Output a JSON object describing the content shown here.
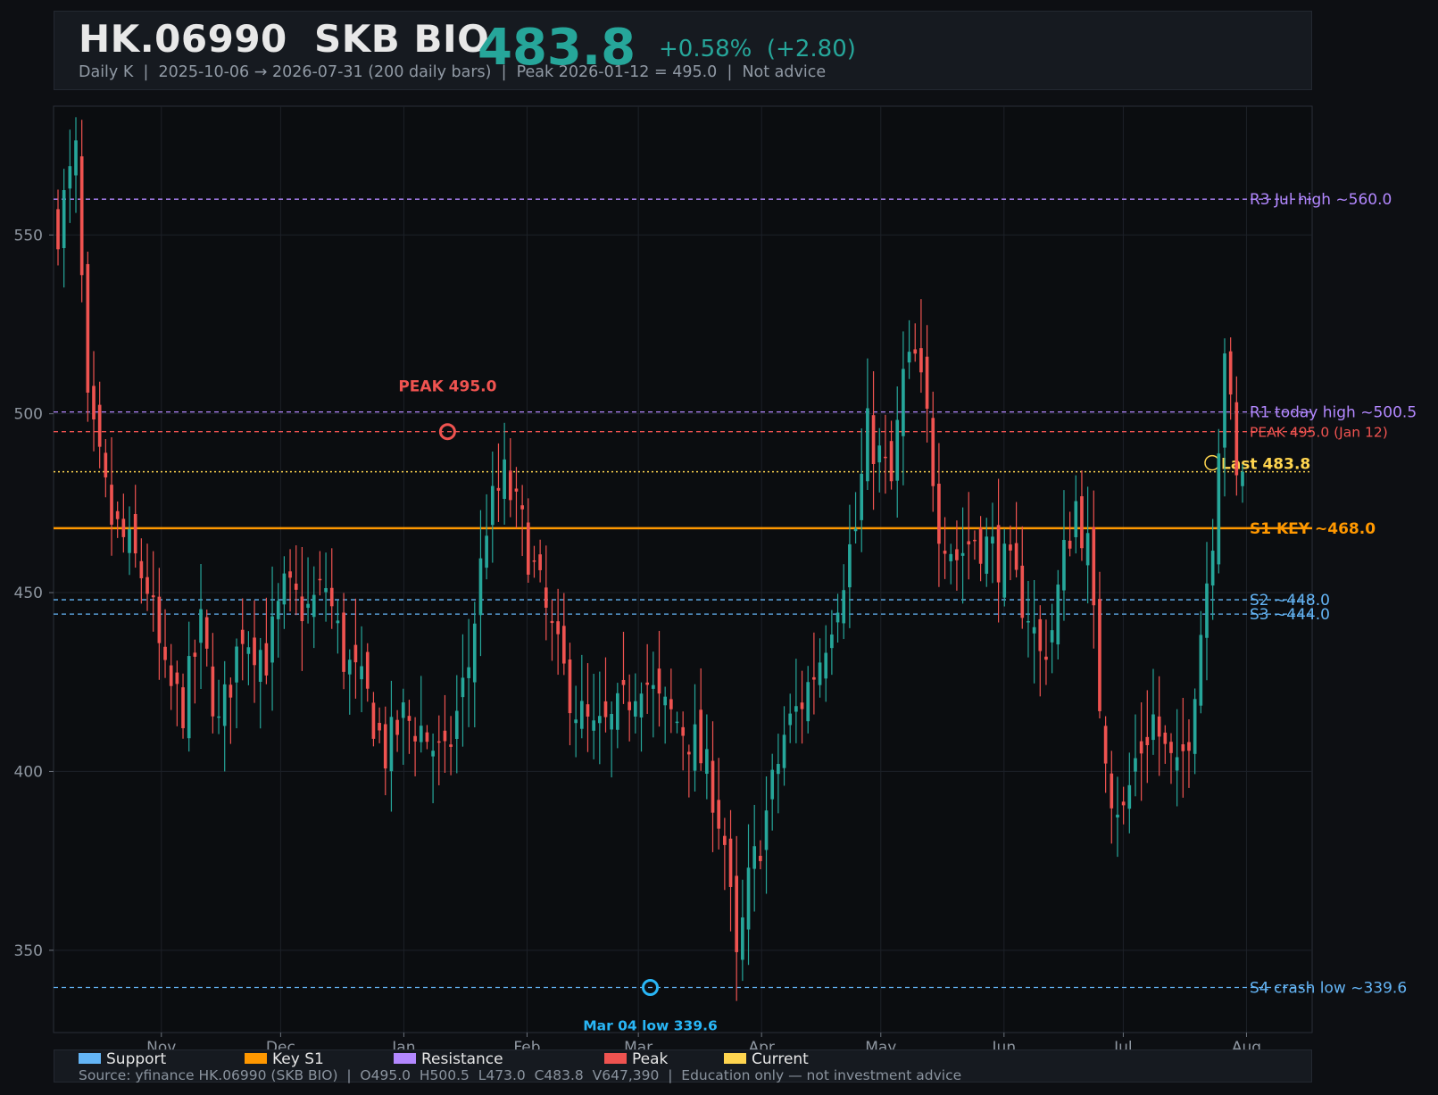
{
  "header": {
    "ticker": "HK.06990  SKB BIO",
    "price": "483.8",
    "change": "+0.58%  (+2.80)",
    "subtitle": "Daily K  |  2025-10-06 → 2026-07-31 (200 daily bars)  |  Peak 2026-01-12 = 495.0  |  Not advice"
  },
  "colors": {
    "up": "#26a69a",
    "down": "#ef5350",
    "support": "#64b5f6",
    "key_s1": "#ff9800",
    "resistance": "#b388ff",
    "peak": "#ef5350",
    "current": "#ffd54f",
    "low_marker": "#29b6f6"
  },
  "chart_data": {
    "type": "candlestick",
    "x_start": "2025-10-06",
    "x_end": "2026-07-31",
    "bar_count": 200,
    "ylim": [
      327,
      586
    ],
    "yticks": [
      350,
      400,
      450,
      500,
      550
    ],
    "xticks": [
      "Nov",
      "Dec",
      "Jan",
      "Feb",
      "Mar",
      "Apr",
      "May",
      "Jun",
      "Jul",
      "Aug"
    ],
    "grid": true,
    "price_path": [
      [
        0,
        553
      ],
      [
        3,
        572
      ],
      [
        5,
        500
      ],
      [
        9,
        470
      ],
      [
        12,
        462
      ],
      [
        15,
        452
      ],
      [
        18,
        425
      ],
      [
        21,
        418
      ],
      [
        24,
        440
      ],
      [
        27,
        412
      ],
      [
        31,
        440
      ],
      [
        35,
        432
      ],
      [
        38,
        450
      ],
      [
        42,
        445
      ],
      [
        45,
        452
      ],
      [
        48,
        432
      ],
      [
        52,
        420
      ],
      [
        55,
        405
      ],
      [
        58,
        415
      ],
      [
        61,
        412
      ],
      [
        65,
        402
      ],
      [
        69,
        430
      ],
      [
        72,
        470
      ],
      [
        75,
        482
      ],
      [
        78,
        468
      ],
      [
        81,
        450
      ],
      [
        84,
        432
      ],
      [
        87,
        418
      ],
      [
        90,
        410
      ],
      [
        93,
        413
      ],
      [
        95,
        418
      ],
      [
        98,
        428
      ],
      [
        101,
        418
      ],
      [
        104,
        414
      ],
      [
        107,
        408
      ],
      [
        110,
        395
      ],
      [
        112,
        380
      ],
      [
        114,
        345
      ],
      [
        116,
        368
      ],
      [
        119,
        388
      ],
      [
        122,
        410
      ],
      [
        125,
        420
      ],
      [
        128,
        432
      ],
      [
        131,
        450
      ],
      [
        134,
        468
      ],
      [
        136,
        495
      ],
      [
        138,
        488
      ],
      [
        140,
        480
      ],
      [
        142,
        510
      ],
      [
        144,
        515
      ],
      [
        146,
        498
      ],
      [
        148,
        470
      ],
      [
        151,
        460
      ],
      [
        154,
        466
      ],
      [
        157,
        462
      ],
      [
        160,
        455
      ],
      [
        163,
        445
      ],
      [
        165,
        432
      ],
      [
        167,
        440
      ],
      [
        169,
        460
      ],
      [
        171,
        475
      ],
      [
        173,
        462
      ],
      [
        175,
        420
      ],
      [
        177,
        395
      ],
      [
        179,
        388
      ],
      [
        181,
        403
      ],
      [
        184,
        415
      ],
      [
        186,
        405
      ],
      [
        188,
        398
      ],
      [
        190,
        412
      ],
      [
        192,
        440
      ],
      [
        194,
        468
      ],
      [
        196,
        520
      ],
      [
        198,
        480
      ],
      [
        199,
        472
      ]
    ],
    "levels": [
      {
        "label": "R3 Jul high ~560.0",
        "value": 560.0,
        "kind": "resistance"
      },
      {
        "label": "R1 today high ~500.5",
        "value": 500.5,
        "kind": "resistance"
      },
      {
        "label": "PEAK 495.0 (Jan 12)",
        "value": 495.0,
        "kind": "peak"
      },
      {
        "label": "S1 KEY ~468.0",
        "value": 468.0,
        "kind": "key_s1"
      },
      {
        "label": "S2 ~448.0",
        "value": 448.0,
        "kind": "support"
      },
      {
        "label": "S3 ~444.0",
        "value": 444.0,
        "kind": "support"
      },
      {
        "label": "S4 crash low ~339.6",
        "value": 339.6,
        "kind": "support"
      }
    ],
    "current": {
      "value": 483.8,
      "label": "Last 483.8"
    },
    "annotations": [
      {
        "label": "PEAK 495.0",
        "date": "2026-01-12",
        "value": 495.0,
        "kind": "peak"
      },
      {
        "label": "Mar 04 low 339.6",
        "date": "2026-03-04",
        "value": 339.6,
        "kind": "low"
      }
    ]
  },
  "legend": [
    {
      "label": "Support",
      "color": "#64b5f6"
    },
    {
      "label": "Key S1",
      "color": "#ff9800"
    },
    {
      "label": "Resistance",
      "color": "#b388ff"
    },
    {
      "label": "Peak",
      "color": "#ef5350"
    },
    {
      "label": "Current",
      "color": "#ffd54f"
    }
  ],
  "footer": {
    "source": "Source: yfinance HK.06990 (SKB BIO)  |  O495.0  H500.5  L473.0  C483.8  V647,390  |  Education only — not investment advice"
  }
}
